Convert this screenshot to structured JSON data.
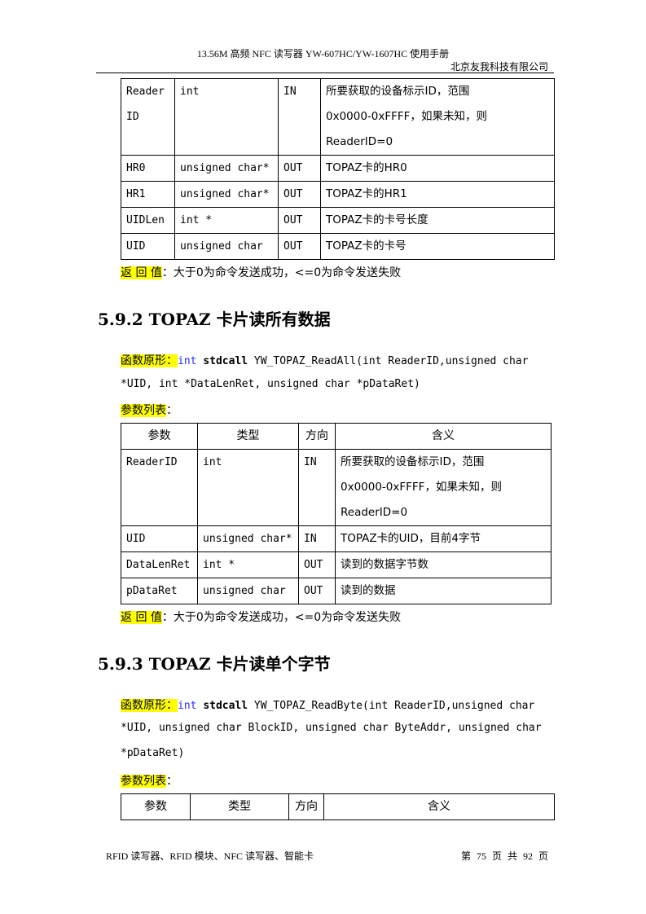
{
  "header": {
    "title": "13.56M 高频 NFC 读写器 YW-607HC/YW-1607HC 使用手册",
    "company": "北京友我科技有限公司"
  },
  "table1": {
    "rows": [
      {
        "param": "Reader ID",
        "type": "int",
        "dir": "IN",
        "desc_lines": [
          "所要获取的设备标示ID，范围",
          "0x0000-0xFFFF，如果未知，则",
          "ReaderID=0"
        ]
      },
      {
        "param": "HR0",
        "type": "unsigned char*",
        "dir": "OUT",
        "desc": "TOPAZ卡的HR0"
      },
      {
        "param": "HR1",
        "type": "unsigned char*",
        "dir": "OUT",
        "desc": "TOPAZ卡的HR1"
      },
      {
        "param": "UIDLen",
        "type": "int *",
        "dir": "OUT",
        "desc": "TOPAZ卡的卡号长度"
      },
      {
        "param": "UID",
        "type": "unsigned char",
        "dir": "OUT",
        "desc": "TOPAZ卡的卡号"
      }
    ],
    "return_label": "返 回 值",
    "return_text": "：大于0为命令发送成功，<=0为命令发送失败"
  },
  "section2": {
    "title": "5.9.2 TOPAZ 卡片读所有数据",
    "proto_label": "函数原形：",
    "proto_kw": "int",
    "proto_call": "stdcall",
    "proto_line1": " YW_TOPAZ_ReadAll(int ReaderID,unsigned char",
    "proto_line2": "*UID, int *DataLenRet, unsigned char *pDataRet)",
    "params_label": "参数列表",
    "params_colon": "：",
    "headers": [
      "参数",
      "类型",
      "方向",
      "含义"
    ],
    "rows": [
      {
        "param": "ReaderID",
        "type": "int",
        "dir": "IN",
        "desc_lines": [
          "所要获取的设备标示ID，范围",
          "0x0000-0xFFFF，如果未知，则",
          "ReaderID=0"
        ]
      },
      {
        "param": "UID",
        "type": "unsigned char*",
        "dir": "IN",
        "desc": "TOPAZ卡的UID，目前4字节"
      },
      {
        "param": "DataLenRet",
        "type": "int *",
        "dir": "OUT",
        "desc": "读到的数据字节数"
      },
      {
        "param": "pDataRet",
        "type": "unsigned char",
        "dir": "OUT",
        "desc": "读到的数据"
      }
    ],
    "return_label": "返 回 值",
    "return_text": "：大于0为命令发送成功，<=0为命令发送失败"
  },
  "section3": {
    "title": "5.9.3 TOPAZ 卡片读单个字节",
    "proto_label": "函数原形：",
    "proto_kw": "int",
    "proto_call": "stdcall",
    "proto_line1": " YW_TOPAZ_ReadByte(int ReaderID,unsigned char",
    "proto_line2": "*UID, unsigned char BlockID, unsigned char ByteAddr, unsigned char",
    "proto_line3": "*pDataRet)",
    "params_label": "参数列表",
    "params_colon": "：",
    "headers": [
      "参数",
      "类型",
      "方向",
      "含义"
    ]
  },
  "footer": {
    "left": "RFID 读写器、RFID 模块、NFC 读写器、智能卡",
    "right": "第 75 页 共 92 页"
  }
}
